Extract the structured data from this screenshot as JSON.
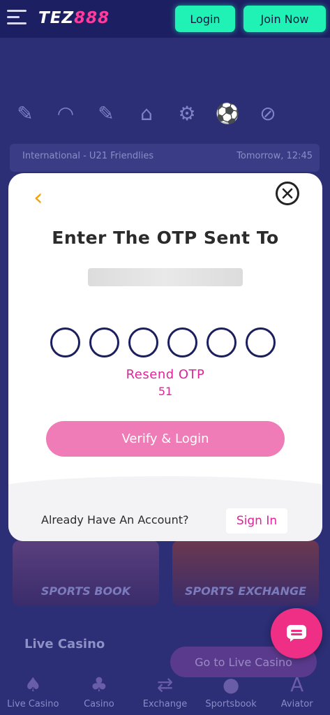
{
  "header": {
    "logo_part1": "TEZ",
    "logo_part2": "888",
    "login_label": "Login",
    "join_label": "Join Now"
  },
  "background": {
    "match_left": "International - U21 Friendlies",
    "match_right": "Tomorrow, 12:45",
    "tile1_label": "SPORTS BOOK",
    "tile2_label": "SPORTS EXCHANGE",
    "live_casino_title": "Live Casino",
    "goto_live_label": "Go to Live Casino",
    "sport_icons": [
      "cricket-icon",
      "support-icon",
      "tennis-icon",
      "football-icon",
      "esports-icon",
      "soccer-ball-icon",
      "racket-icon"
    ],
    "bottom_nav": [
      {
        "label": "Live Casino",
        "icon": "cards-icon"
      },
      {
        "label": "Casino",
        "icon": "chips-icon"
      },
      {
        "label": "Exchange",
        "icon": "exchange-icon"
      },
      {
        "label": "Sportsbook",
        "icon": "ball-icon"
      },
      {
        "label": "Aviator",
        "icon": "aviator-icon"
      }
    ]
  },
  "modal": {
    "title": "Enter The OTP Sent To",
    "otp_length": 6,
    "resend_label": "Resend OTP",
    "timer": "51",
    "verify_label": "Verify & Login",
    "footer_text": "Already Have An Account?",
    "signin_label": "Sign In"
  },
  "colors": {
    "accent_green": "#1ff2b4",
    "accent_pink": "#e0239a",
    "verify_button": "#ef7cb7",
    "back_arrow": "#f0a400",
    "header_bg": "#1d1f63"
  }
}
